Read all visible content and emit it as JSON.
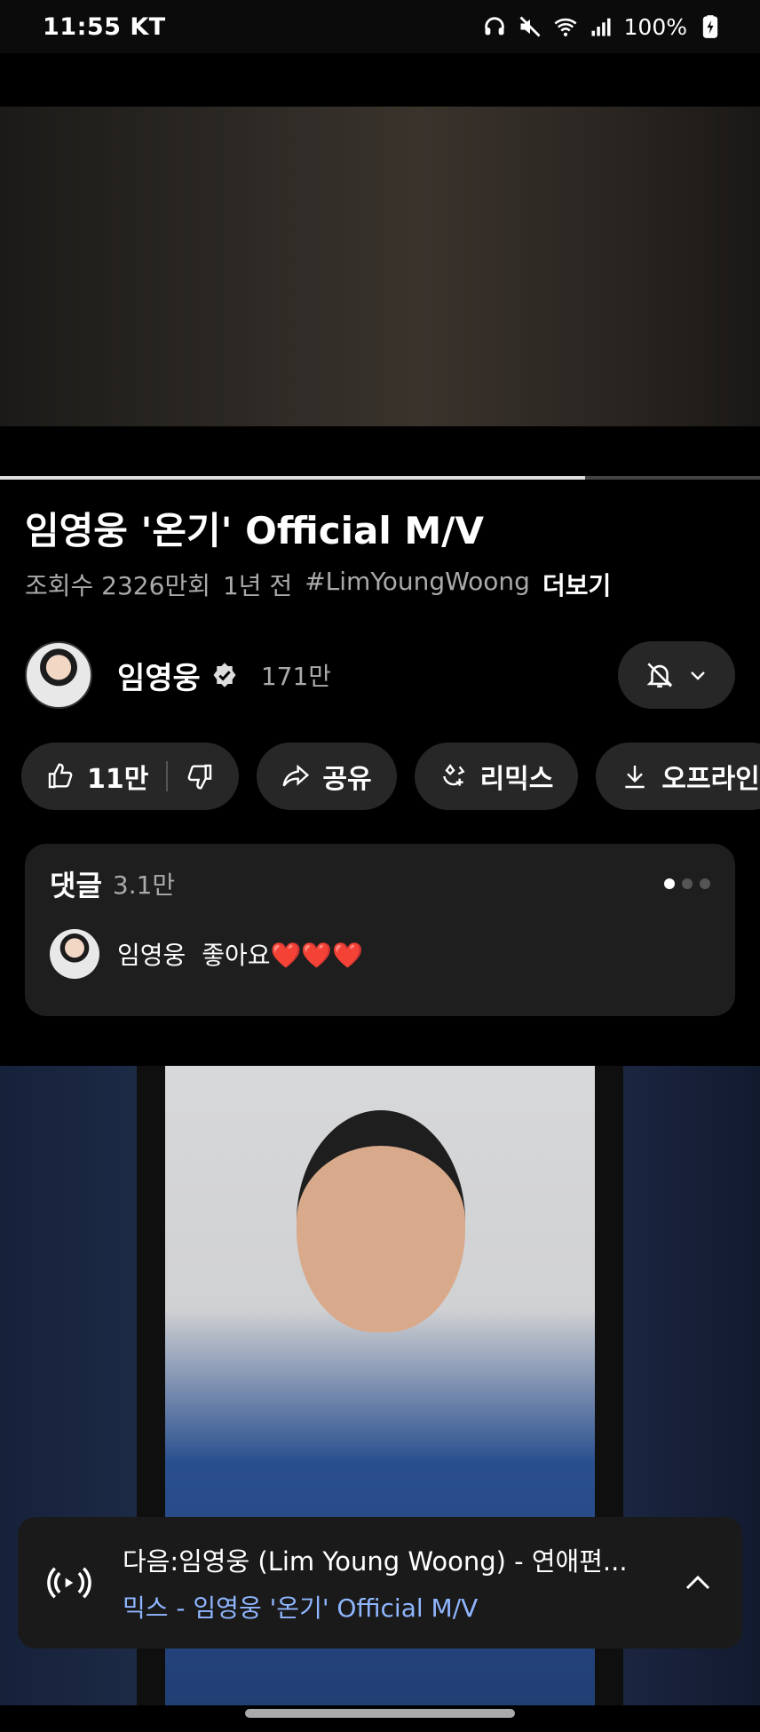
{
  "status_bar": {
    "time": "11:55",
    "carrier": "KT",
    "battery": "100%"
  },
  "video": {
    "title": "임영웅 '온기' Official M/V",
    "views": "조회수 2326만회",
    "age": "1년 전",
    "hashtag": "#LimYoungWoong",
    "more_label": "더보기",
    "progress_fraction": 0.77
  },
  "channel": {
    "name": "임영웅",
    "subscribers": "171만"
  },
  "actions": {
    "like_count": "11만",
    "share_label": "공유",
    "remix_label": "리믹스",
    "offline_label": "오프라인"
  },
  "comments": {
    "label": "댓글",
    "count": "3.1만",
    "top_comment_author": "임영웅",
    "top_comment_text": "좋아요❤️❤️❤️"
  },
  "up_next": {
    "title": "다음:임영웅 (Lim Young Woong) - 연애편...",
    "playlist": "믹스 - 임영웅 '온기' Official M/V"
  },
  "icons": [
    "headphones-icon",
    "mute-icon",
    "wifi-icon",
    "signal-icon",
    "battery-icon",
    "verified-icon",
    "bell-off-icon",
    "chevron-down-icon",
    "like-icon",
    "dislike-icon",
    "share-icon",
    "remix-icon",
    "download-icon",
    "radio-icon",
    "chevron-up-icon"
  ],
  "colors": {
    "background": "#000000",
    "chip": "#272727",
    "card": "#1e1e1e",
    "link": "#8fb6ff"
  }
}
